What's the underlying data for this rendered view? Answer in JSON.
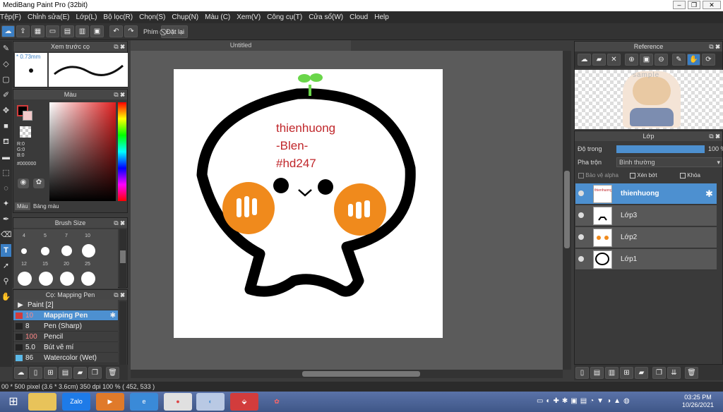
{
  "window": {
    "title": "MediBang Paint Pro (32bit)",
    "controls": [
      "–",
      "❐",
      "✕"
    ]
  },
  "menu": [
    "Tệp(F)",
    "Chỉnh sửa(E)",
    "Lớp(L)",
    "Bộ lọc(R)",
    "Chọn(S)",
    "Chụp(N)",
    "Màu (C)",
    "Xem(V)",
    "Công cụ(T)",
    "Cửa sổ(W)",
    "Cloud",
    "Help"
  ],
  "toolbar": {
    "shortcut_label": "Phím",
    "reset_label": "Đặt lại"
  },
  "brush_preview": {
    "title": "Xem trước cọ",
    "size": "0.73mm"
  },
  "color_panel": {
    "title": "Màu",
    "r": "R:0",
    "g": "G:0",
    "b": "B:0",
    "hex": "#000000",
    "tab_color": "Màu",
    "tab_palette": "Bảng màu"
  },
  "brush_size": {
    "title": "Brush Size",
    "sizes": [
      "4",
      "5",
      "7",
      "10",
      "12",
      "15",
      "20",
      "25"
    ]
  },
  "brush_list": {
    "title": "Cọ: Mapping Pen",
    "group": "Paint [2]",
    "items": [
      {
        "size": "10",
        "name": "Mapping Pen",
        "color": "#d23c3c",
        "selected": true
      },
      {
        "size": "8",
        "name": "Pen (Sharp)",
        "color": "#222222",
        "selected": false
      },
      {
        "size": "100",
        "name": "Pencil",
        "color": "#222222",
        "selected": false
      },
      {
        "size": "5.0",
        "name": "Bút vẽ mí",
        "color": "#222222",
        "selected": false
      },
      {
        "size": "86",
        "name": "Watercolor (Wet)",
        "color": "#5bb9e8",
        "selected": false
      }
    ]
  },
  "document": {
    "tab": "Untitled"
  },
  "canvas_text": {
    "line1": "thienhuong",
    "line2": "-Blen-",
    "line3": "#hd247"
  },
  "reference": {
    "title": "Reference",
    "watermark": "sample"
  },
  "layers": {
    "title": "Lớp",
    "opacity_label": "Độ trong",
    "opacity_value": "100 %",
    "opacity_fraction": 1.0,
    "blend_label": "Pha trộn",
    "blend_value": "Bình thường",
    "protect_alpha": "Bảo vệ alpha",
    "clipping": "Xén bớt",
    "lock": "Khóa",
    "items": [
      {
        "name": "thienhuong",
        "selected": true
      },
      {
        "name": "Lớp3",
        "selected": false
      },
      {
        "name": "Lớp2",
        "selected": false
      },
      {
        "name": "Lớp1",
        "selected": false
      }
    ]
  },
  "status": {
    "text": "00 * 500 pixel   (3.6 * 3.6cm)  350 dpi  100 %  ( 452, 533 )"
  },
  "taskbar": {
    "time": "03:25 PM",
    "date": "10/26/2021",
    "zalo": "Zalo"
  },
  "colors": {
    "accent": "#4d90d0",
    "panel_bg": "#3a3a3a",
    "canvas_bg": "#5b5b5b",
    "selected_layer": "#4d90d0",
    "canvas_text": "#c0262a"
  }
}
